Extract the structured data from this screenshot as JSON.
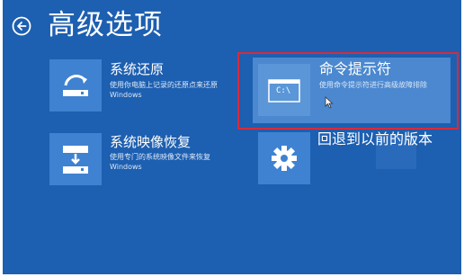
{
  "header": {
    "back_icon": "back-arrow-icon",
    "title": "高级选项"
  },
  "options": {
    "system_restore": {
      "title": "系统还原",
      "desc_line1": "使用你电脑上记录的还原点来还原",
      "desc_line2": "Windows",
      "icon": "restore-icon"
    },
    "command_prompt": {
      "title": "命令提示符",
      "desc": "使用命令提示符进行高级故障排除",
      "icon_text": "C:\\",
      "icon": "console-icon"
    },
    "system_image_recovery": {
      "title": "系统映像恢复",
      "desc_line1": "使用专门的系统映像文件来恢复",
      "desc_line2": "Windows",
      "icon": "image-recovery-icon"
    },
    "go_back": {
      "title": "回退到以前的版本",
      "icon": "gear-icon"
    }
  },
  "colors": {
    "background": "#1d5fb0",
    "tile_icon": "#3f82d1",
    "selected_tile": "#4b88cf",
    "highlight_frame": "#d72b3a"
  }
}
